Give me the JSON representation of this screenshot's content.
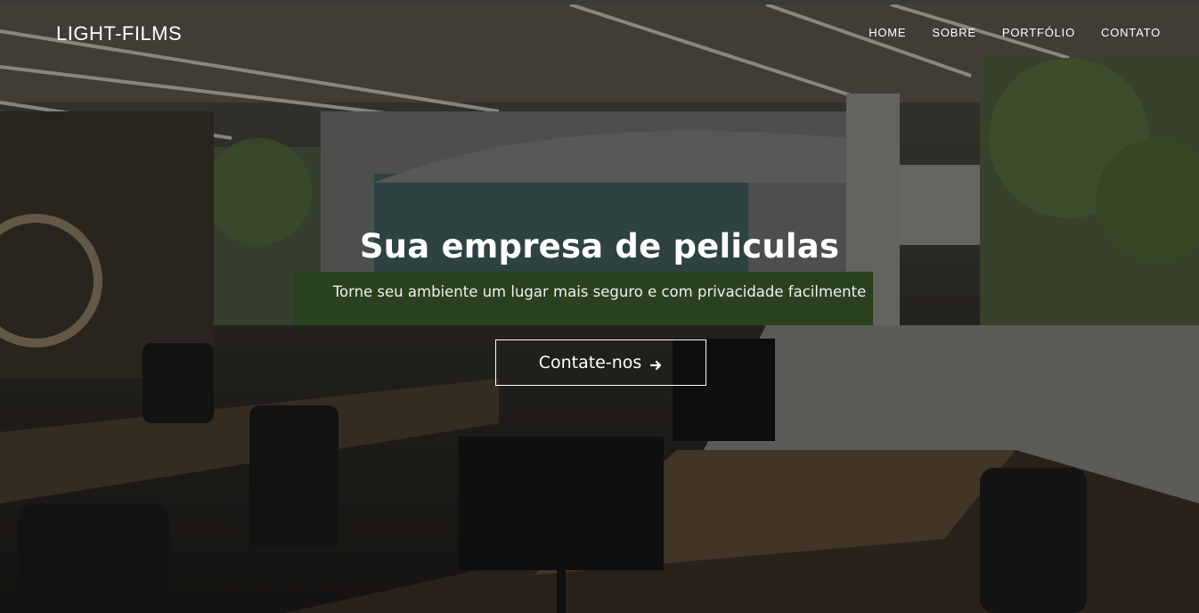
{
  "brand": {
    "name": "LIGHT-FILMS"
  },
  "nav": {
    "items": [
      {
        "label": "HOME"
      },
      {
        "label": "SOBRE"
      },
      {
        "label": "PORTFÓLIO"
      },
      {
        "label": "CONTATO"
      }
    ]
  },
  "hero": {
    "title": "Sua empresa de peliculas",
    "subtitle": "Torne seu ambiente um lugar mais seguro e com privacidade facilmente",
    "cta_label": "Contate-nos",
    "cta_icon": "arrow-right-icon",
    "background_image": "office-with-glass-walls-photo"
  }
}
